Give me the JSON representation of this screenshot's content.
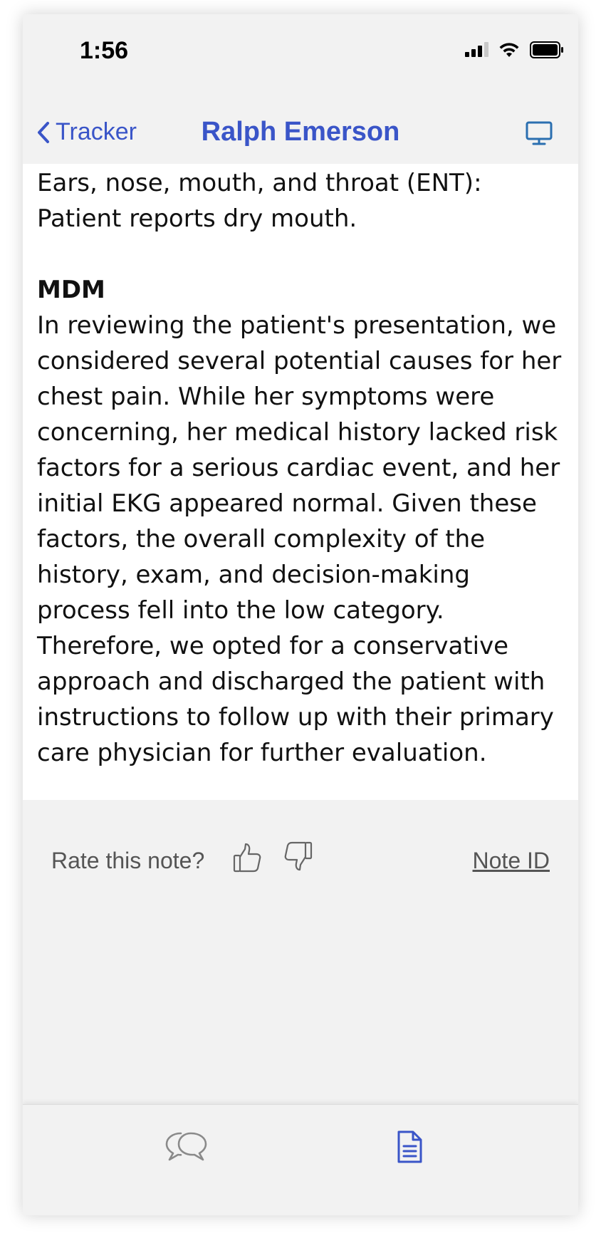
{
  "status_bar": {
    "time": "1:56",
    "icons": [
      "cellular-signal-icon",
      "wifi-icon",
      "battery-icon"
    ]
  },
  "nav": {
    "back_label": "Tracker",
    "back_icon": "chevron-left-icon",
    "title": "Ralph Emerson",
    "right_icon": "desktop-monitor-icon"
  },
  "note": {
    "ent_text": "Ears, nose, mouth, and throat (ENT): Patient reports dry mouth.",
    "mdm_heading": "MDM",
    "mdm_text": "In reviewing the patient's presentation, we considered several potential causes for her chest pain. While her symptoms were concerning, her medical history lacked risk factors for a serious cardiac event, and her initial EKG appeared normal. Given these factors, the overall complexity of the history, exam, and decision-making process fell into the low category.  Therefore, we opted for a conservative approach and discharged the patient with instructions to follow up with their primary care physician for further evaluation."
  },
  "rating": {
    "prompt": "Rate this note?",
    "thumbs_up_icon": "thumbs-up-icon",
    "thumbs_down_icon": "thumbs-down-icon",
    "note_id_label": "Note ID"
  },
  "tab_bar": {
    "tabs": [
      {
        "icon": "chat-bubbles-icon",
        "active": false
      },
      {
        "icon": "document-icon",
        "active": true
      }
    ]
  },
  "colors": {
    "accent": "#3a55c8",
    "background": "#f2f2f2",
    "note_background": "#ffffff",
    "secondary_text": "#555555",
    "inactive_icon": "#8a8a8a"
  }
}
